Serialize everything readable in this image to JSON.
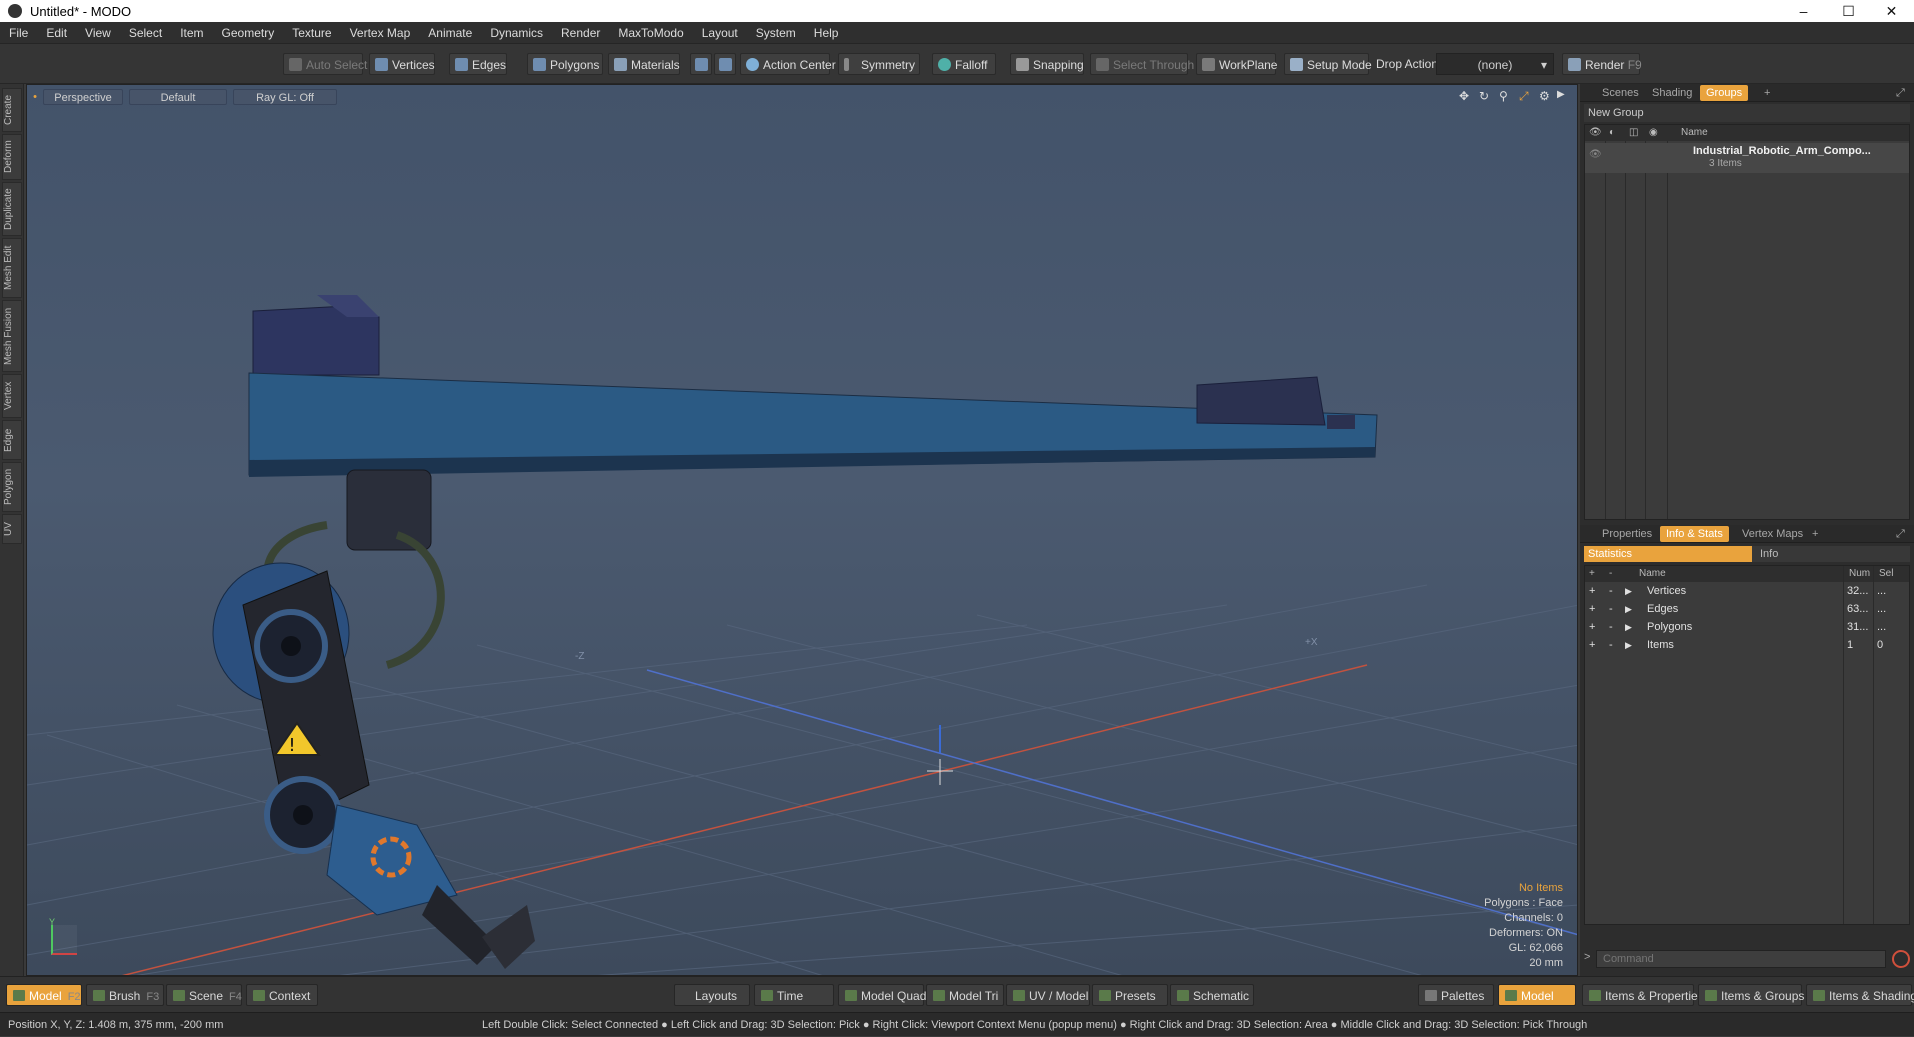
{
  "window": {
    "title": "Untitled* - MODO",
    "min": "–",
    "max": "☐",
    "close": "✕"
  },
  "menu": [
    "File",
    "Edit",
    "View",
    "Select",
    "Item",
    "Geometry",
    "Texture",
    "Vertex Map",
    "Animate",
    "Dynamics",
    "Render",
    "MaxToModo",
    "Layout",
    "System",
    "Help"
  ],
  "toolbar": {
    "auto_select": "Auto Select",
    "vertices": "Vertices",
    "edges": "Edges",
    "polygons": "Polygons",
    "materials": "Materials",
    "action_center": "Action Center",
    "symmetry": "Symmetry",
    "falloff": "Falloff",
    "snapping": "Snapping",
    "select_through": "Select Through",
    "workplane": "WorkPlane",
    "setup_mode": "Setup Mode",
    "drop_action_label": "Drop Action",
    "drop_action_value": "(none)",
    "render": "Render",
    "render_key": "F9"
  },
  "left_tabs": [
    "Create",
    "Deform",
    "Duplicate",
    "Mesh Edit",
    "Mesh Fusion",
    "Vertex",
    "Edge",
    "Polygon",
    "UV"
  ],
  "viewport": {
    "perspective": "Perspective",
    "default": "Default",
    "raygl": "Ray GL: Off",
    "axis_z": "-Z",
    "axis_x": "+X",
    "axis_y": "Y",
    "hud": {
      "no_items": "No Items",
      "polygons": "Polygons : Face",
      "channels": "Channels: 0",
      "deformers": "Deformers: ON",
      "gl": "GL: 62,066",
      "scale": "20 mm"
    }
  },
  "scene_panel": {
    "tabs": [
      "Scenes",
      "Shading",
      "Groups"
    ],
    "active_tab": "Groups",
    "new_group": "New Group",
    "col_name": "Name",
    "item_name": "Industrial_Robotic_Arm_Compo...",
    "item_sub": "3 Items"
  },
  "info_panel": {
    "tabs": [
      "Properties",
      "Info & Stats",
      "Vertex Maps"
    ],
    "active_tab": "Info & Stats",
    "sub_tabs": [
      "Statistics",
      "Info"
    ],
    "cols": {
      "name": "Name",
      "num": "Num",
      "sel": "Sel"
    },
    "rows": [
      {
        "name": "Vertices",
        "num": "32...",
        "sel": "..."
      },
      {
        "name": "Edges",
        "num": "63...",
        "sel": "..."
      },
      {
        "name": "Polygons",
        "num": "31...",
        "sel": "..."
      },
      {
        "name": "Items",
        "num": "1",
        "sel": "0"
      }
    ],
    "command_placeholder": "Command"
  },
  "bottom": {
    "model": "Model",
    "model_key": "F2",
    "brush": "Brush",
    "brush_key": "F3",
    "scene": "Scene",
    "scene_key": "F4",
    "context": "Context",
    "layouts": "Layouts",
    "time": "Time",
    "model_quad": "Model Quad",
    "model_tri": "Model Tri",
    "uv_model": "UV / Model",
    "presets": "Presets",
    "schematic": "Schematic",
    "palettes": "Palettes",
    "model2": "Model",
    "items_props": "Items & Properties",
    "items_groups": "Items & Groups",
    "items_shading": "Items & Shading"
  },
  "status": {
    "position": "Position X, Y, Z:  1.408 m, 375 mm, -200 mm",
    "hint": "Left Double Click: Select Connected ● Left Click and Drag: 3D Selection: Pick ● Right Click: Viewport Context Menu (popup menu) ● Right Click and Drag: 3D Selection: Area ● Middle Click and Drag: 3D Selection: Pick Through"
  }
}
